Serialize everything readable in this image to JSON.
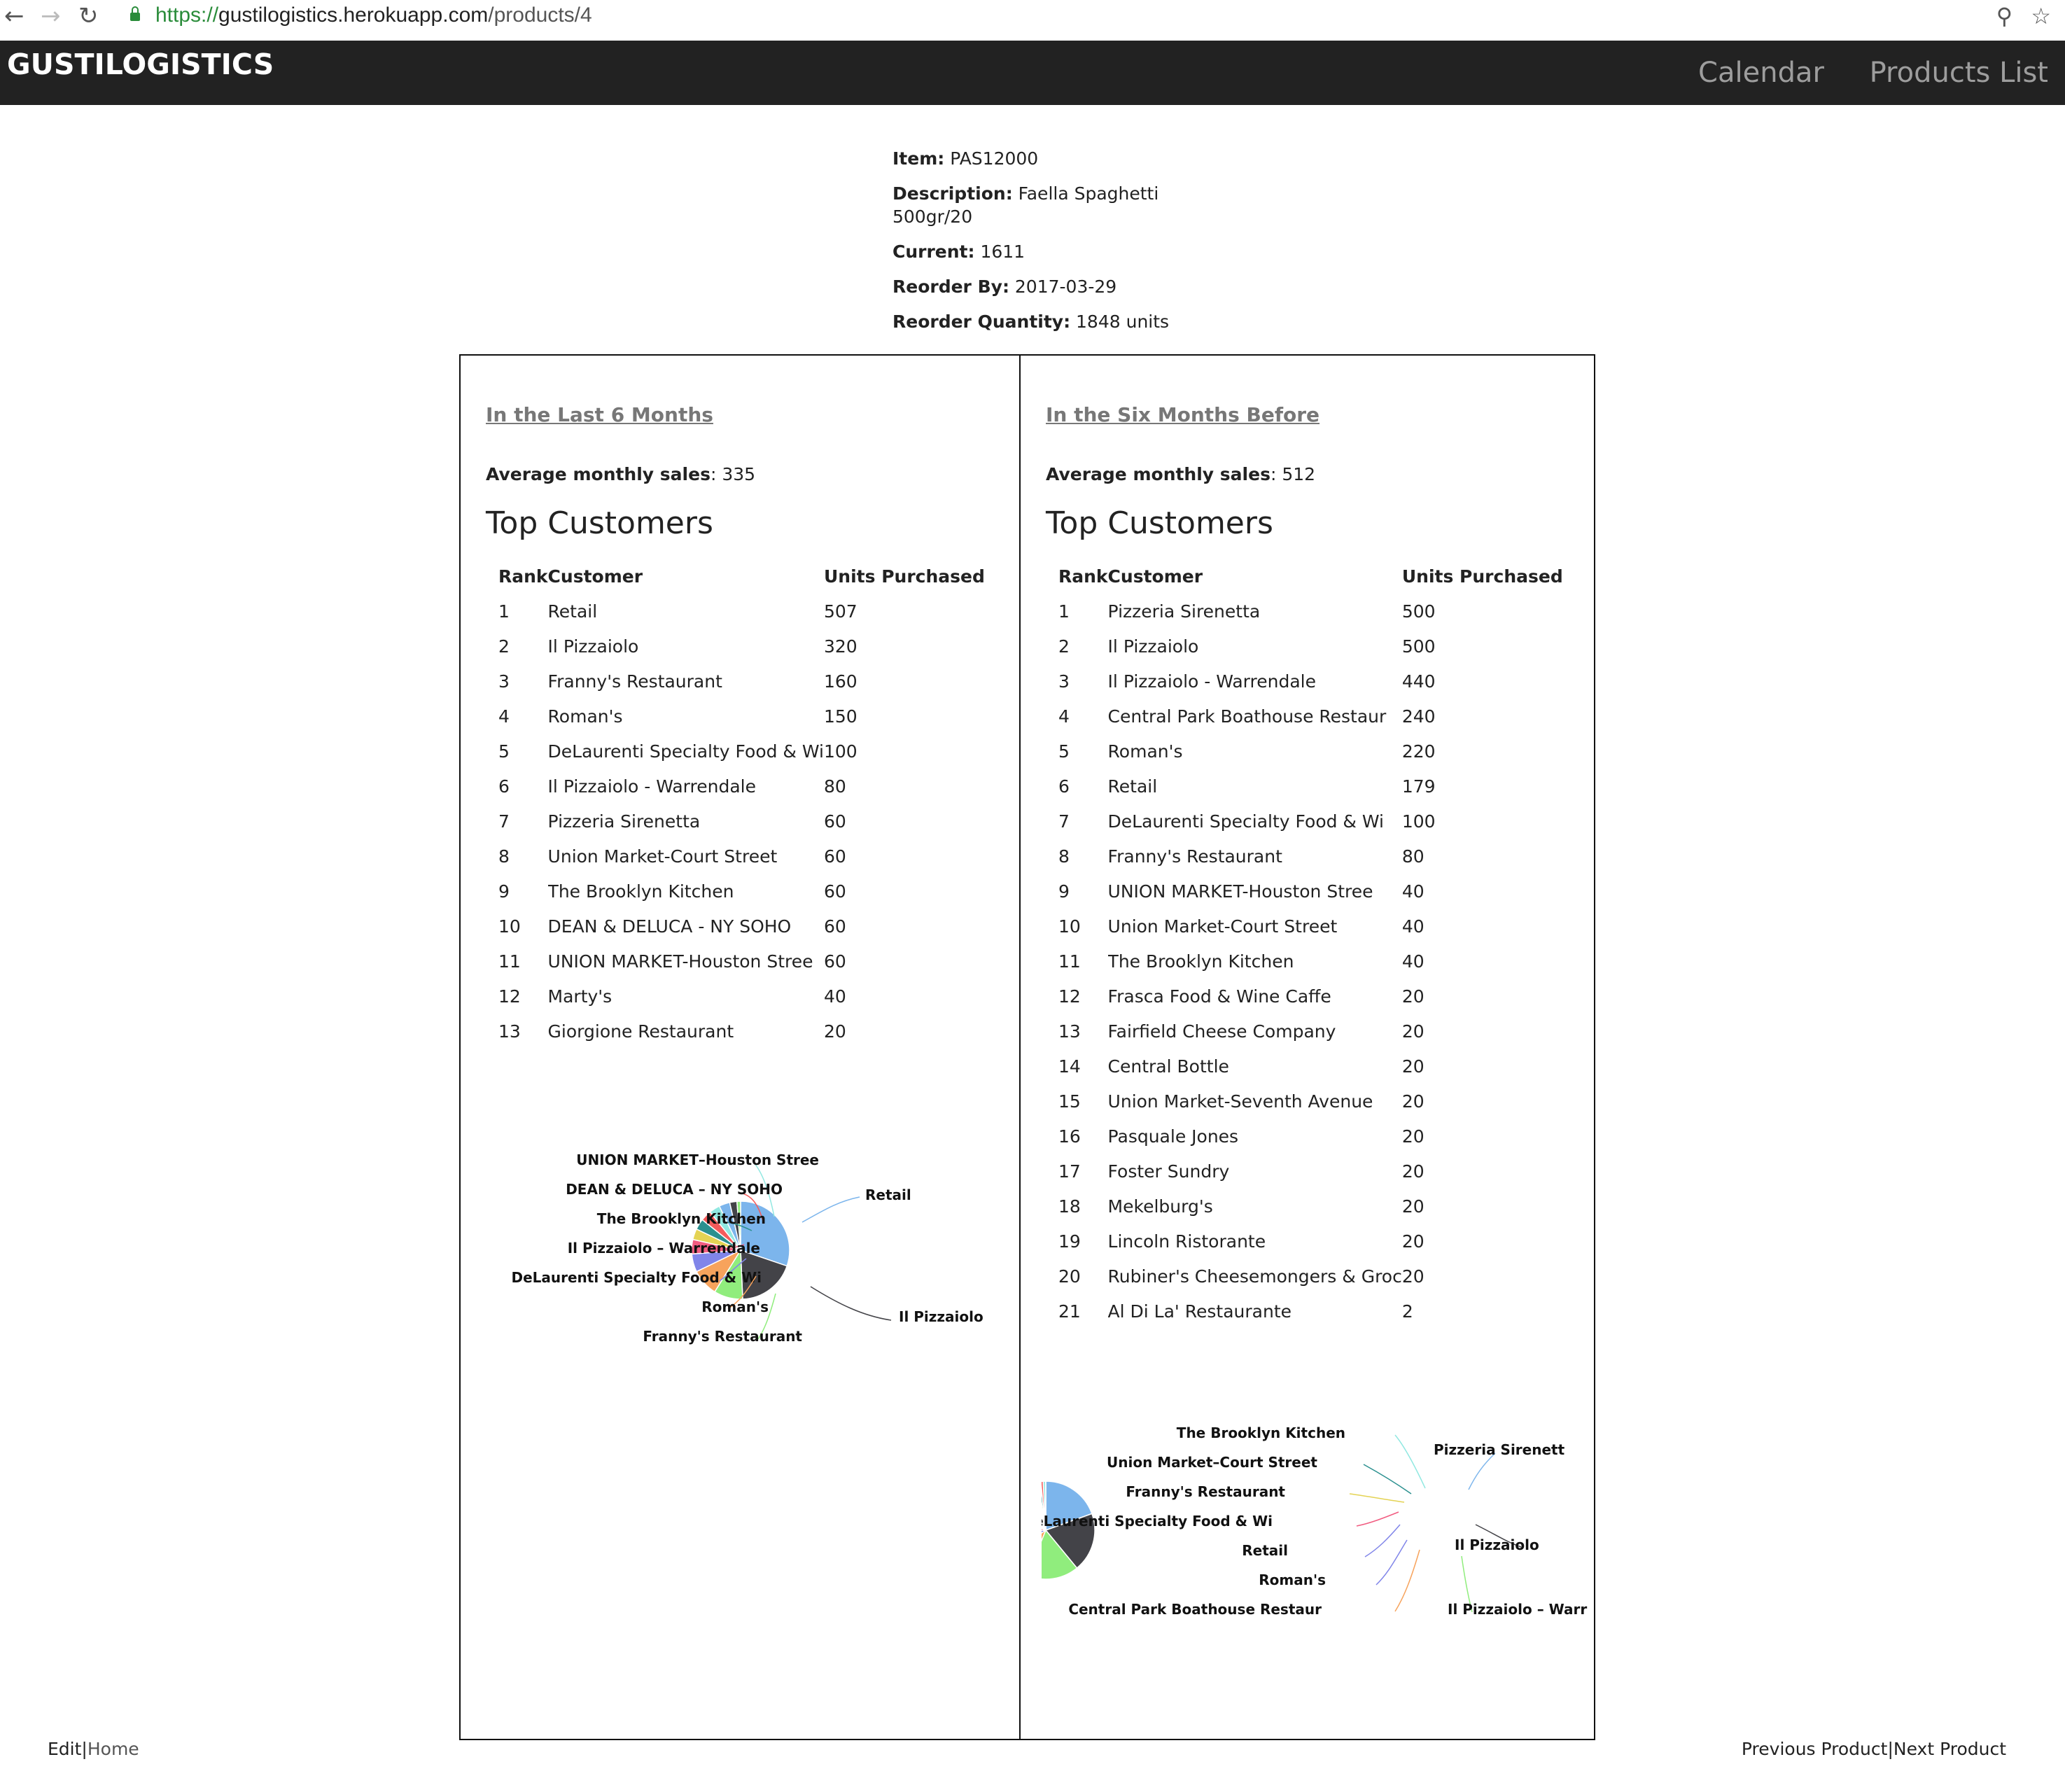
{
  "browser": {
    "url_scheme": "https://",
    "url_host": "gustilogistics.herokuapp.com",
    "url_path": "/products/4"
  },
  "appbar": {
    "brand": "GUSTILOGISTICS",
    "links": [
      "Calendar",
      "Products List"
    ]
  },
  "product": {
    "item_label": "Item:",
    "item": "PAS12000",
    "description_label": "Description:",
    "description_line1": "Faella Spaghetti",
    "description_line2": "500gr/20",
    "current_label": "Current:",
    "current": "1611",
    "reorder_by_label": "Reorder By:",
    "reorder_by": "2017-03-29",
    "reorder_qty_label": "Reorder Quantity:",
    "reorder_qty": "1848 units"
  },
  "panels": [
    {
      "period": "In the Last 6 Months",
      "avg_label": "Average monthly sales",
      "avg_value": ": 335",
      "heading": "Top Customers",
      "columns": [
        "Rank",
        "Customer",
        "Units Purchased"
      ],
      "rows": [
        [
          "1",
          "Retail",
          "507"
        ],
        [
          "2",
          "Il Pizzaiolo",
          "320"
        ],
        [
          "3",
          "Franny's Restaurant",
          "160"
        ],
        [
          "4",
          "Roman's",
          "150"
        ],
        [
          "5",
          "DeLaurenti Specialty Food & Wi",
          "100"
        ],
        [
          "6",
          "Il Pizzaiolo - Warrendale",
          "80"
        ],
        [
          "7",
          "Pizzeria Sirenetta",
          "60"
        ],
        [
          "8",
          "Union Market-Court Street",
          "60"
        ],
        [
          "9",
          "The Brooklyn Kitchen",
          "60"
        ],
        [
          "10",
          "DEAN & DELUCA - NY SOHO",
          "60"
        ],
        [
          "11",
          "UNION MARKET-Houston Stree",
          "60"
        ],
        [
          "12",
          "Marty's",
          "40"
        ],
        [
          "13",
          "Giorgione Restaurant",
          "20"
        ]
      ],
      "pie_labels": [
        "UNION MARKET–Houston Stree",
        "DEAN & DELUCA – NY SOHO",
        "The Brooklyn Kitchen",
        "Il Pizzaiolo – Warrendale",
        "DeLaurenti Specialty Food & Wi",
        "Roman's",
        "Franny's Restaurant",
        "Retail",
        "Il Pizzaiolo"
      ]
    },
    {
      "period": "In the Six Months Before",
      "avg_label": "Average monthly sales",
      "avg_value": ": 512",
      "heading": "Top Customers",
      "columns": [
        "Rank",
        "Customer",
        "Units Purchased"
      ],
      "rows": [
        [
          "1",
          "Pizzeria Sirenetta",
          "500"
        ],
        [
          "2",
          "Il Pizzaiolo",
          "500"
        ],
        [
          "3",
          "Il Pizzaiolo - Warrendale",
          "440"
        ],
        [
          "4",
          "Central Park Boathouse Restaur",
          "240"
        ],
        [
          "5",
          "Roman's",
          "220"
        ],
        [
          "6",
          "Retail",
          "179"
        ],
        [
          "7",
          "DeLaurenti Specialty Food & Wi",
          "100"
        ],
        [
          "8",
          "Franny's Restaurant",
          "80"
        ],
        [
          "9",
          "UNION MARKET-Houston Stree",
          "40"
        ],
        [
          "10",
          "Union Market-Court Street",
          "40"
        ],
        [
          "11",
          "The Brooklyn Kitchen",
          "40"
        ],
        [
          "12",
          "Frasca Food & Wine Caffe",
          "20"
        ],
        [
          "13",
          "Fairfield Cheese Company",
          "20"
        ],
        [
          "14",
          "Central Bottle",
          "20"
        ],
        [
          "15",
          "Union Market-Seventh Avenue",
          "20"
        ],
        [
          "16",
          "Pasquale Jones",
          "20"
        ],
        [
          "17",
          "Foster Sundry",
          "20"
        ],
        [
          "18",
          "Mekelburg's",
          "20"
        ],
        [
          "19",
          "Lincoln Ristorante",
          "20"
        ],
        [
          "20",
          "Rubiner's Cheesemongers & Groc",
          "20"
        ],
        [
          "21",
          "Al Di La' Restaurante",
          "2"
        ]
      ],
      "pie_labels": [
        "The Brooklyn Kitchen",
        "Union Market–Court Street",
        "Franny's Restaurant",
        "DeLaurenti Specialty Food & Wi",
        "Retail",
        "Roman's",
        "Central Park Boathouse Restaur",
        "Pizzeria Sirenett",
        "Il Pizzaiolo",
        "Il Pizzaiolo – Warrend"
      ]
    }
  ],
  "pie_colors": [
    "#7cb5ec",
    "#434348",
    "#90ed7d",
    "#f7a35c",
    "#8085e9",
    "#f15c80",
    "#e4d354",
    "#2b908f",
    "#f45b5b",
    "#91e8e1",
    "#7cb5ec",
    "#434348",
    "#90ed7d",
    "#f7a35c",
    "#8085e9",
    "#f15c80",
    "#e4d354",
    "#2b908f",
    "#f45b5b",
    "#91e8e1",
    "#7cb5ec"
  ],
  "footer": {
    "edit": "Edit",
    "sep": "|",
    "home": "Home",
    "prev": "Previous Product",
    "next": "Next Product"
  }
}
